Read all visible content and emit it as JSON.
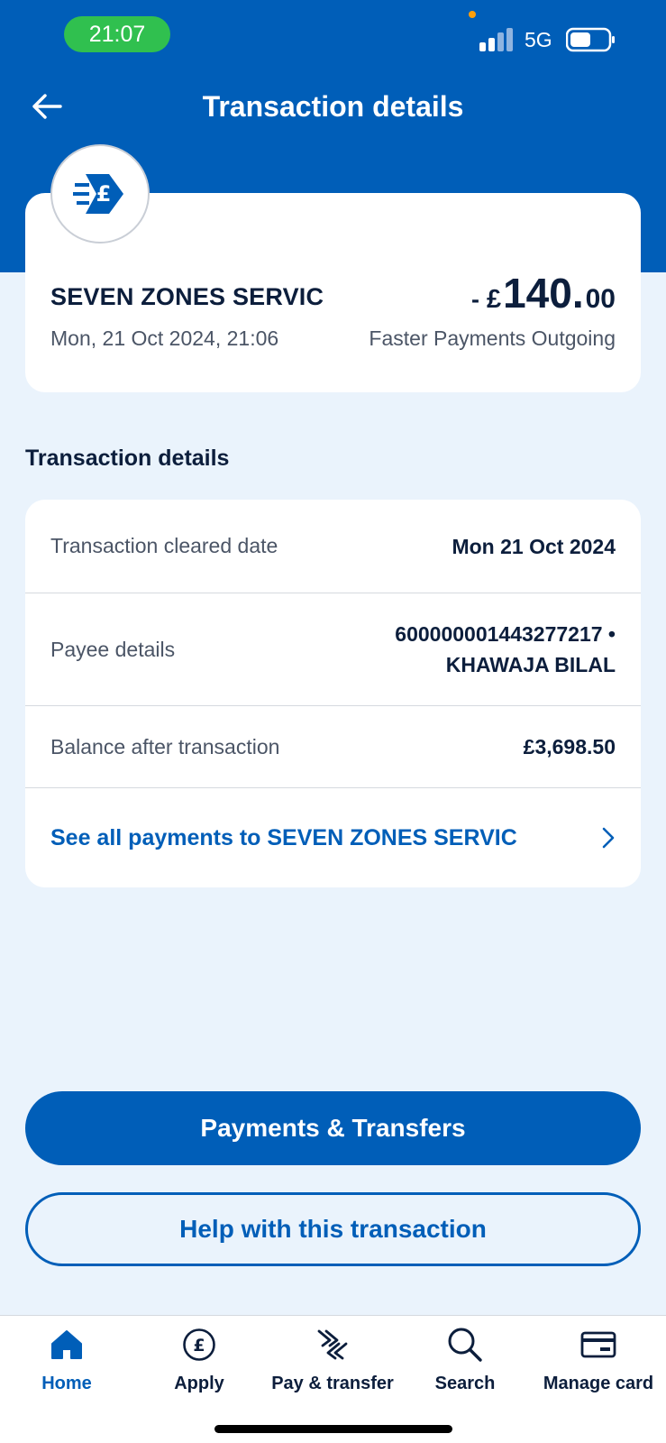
{
  "status_bar": {
    "time": "21:07",
    "network": "5G"
  },
  "header": {
    "title": "Transaction details",
    "back_icon": "arrow-left-icon"
  },
  "summary": {
    "merchant_name": "SEVEN ZONES SERVIC",
    "datetime": "Mon, 21 Oct 2024, 21:06",
    "amount_sign": "-",
    "amount_currency": "£",
    "amount_major": "140.",
    "amount_minor": "00",
    "transaction_type": "Faster Payments Outgoing",
    "logo_icon": "faster-payment-pound-icon"
  },
  "details": {
    "heading": "Transaction details",
    "rows": [
      {
        "label": "Transaction cleared date",
        "value": "Mon 21 Oct 2024"
      },
      {
        "label": "Payee details",
        "value_line1": "600000001443277217 •",
        "value_line2": "KHAWAJA BILAL"
      },
      {
        "label": "Balance after transaction",
        "value": "£3,698.50"
      }
    ],
    "link_text": "See all payments to SEVEN ZONES SERVIC"
  },
  "actions": {
    "primary": "Payments & Transfers",
    "secondary": "Help with this transaction"
  },
  "tabs": [
    {
      "label": "Home",
      "icon": "home-icon",
      "active": true
    },
    {
      "label": "Apply",
      "icon": "pound-circle-icon"
    },
    {
      "label": "Pay & transfer",
      "icon": "transfer-arrows-icon"
    },
    {
      "label": "Search",
      "icon": "search-icon"
    },
    {
      "label": "Manage card",
      "icon": "card-icon"
    }
  ],
  "colors": {
    "brand_blue": "#005eb8",
    "background": "#eaf3fc",
    "time_pill": "#30c04f"
  }
}
